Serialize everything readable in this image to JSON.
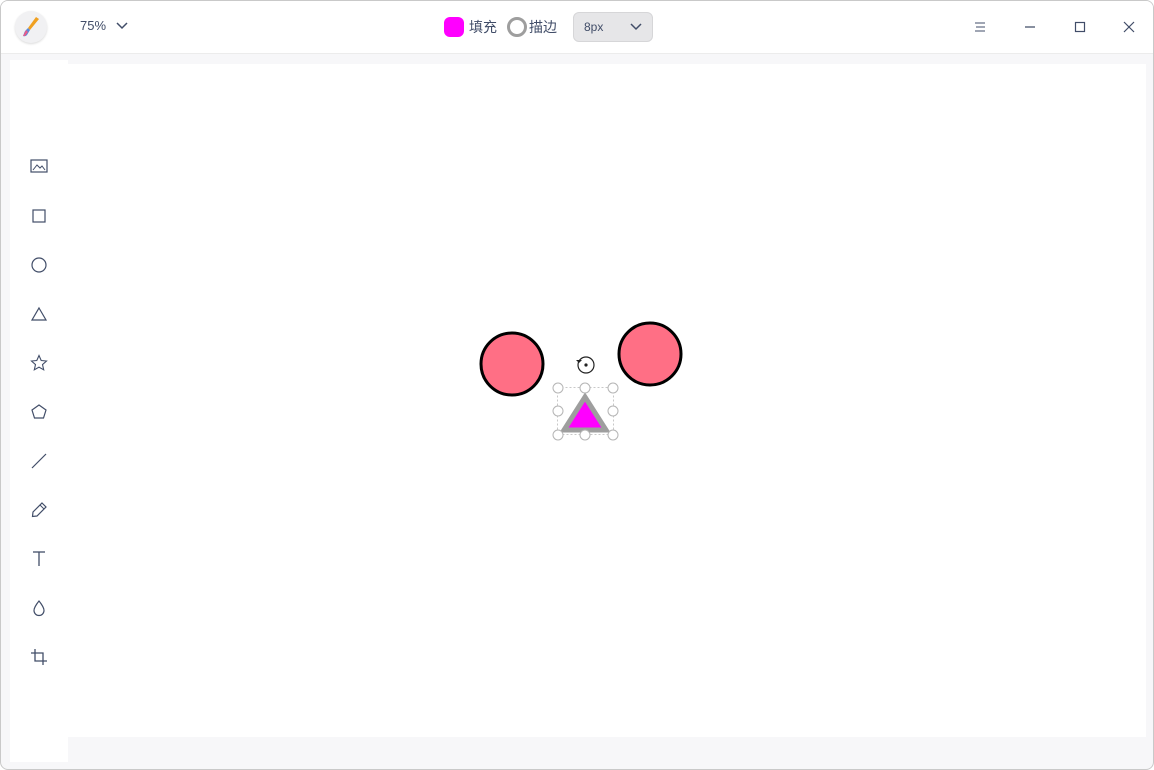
{
  "toolbar": {
    "zoom_value": "75%",
    "fill_label": "填充",
    "fill_color": "#ff00ff",
    "stroke_label": "描边",
    "stroke_color": "#9e9e9e",
    "stroke_width": "8px"
  },
  "tools": [
    {
      "name": "image-icon"
    },
    {
      "name": "rectangle-icon"
    },
    {
      "name": "ellipse-icon"
    },
    {
      "name": "triangle-icon"
    },
    {
      "name": "star-icon"
    },
    {
      "name": "polygon-icon"
    },
    {
      "name": "line-icon"
    },
    {
      "name": "pencil-icon"
    },
    {
      "name": "text-icon"
    },
    {
      "name": "blur-icon"
    },
    {
      "name": "crop-icon"
    }
  ],
  "canvas": {
    "shapes": [
      {
        "type": "circle",
        "fill": "#ff6f85",
        "stroke": "#000000"
      },
      {
        "type": "circle",
        "fill": "#ff6f85",
        "stroke": "#000000"
      },
      {
        "type": "triangle",
        "fill": "#ff00ff",
        "stroke": "#9e9e9e",
        "selected": true
      }
    ]
  }
}
